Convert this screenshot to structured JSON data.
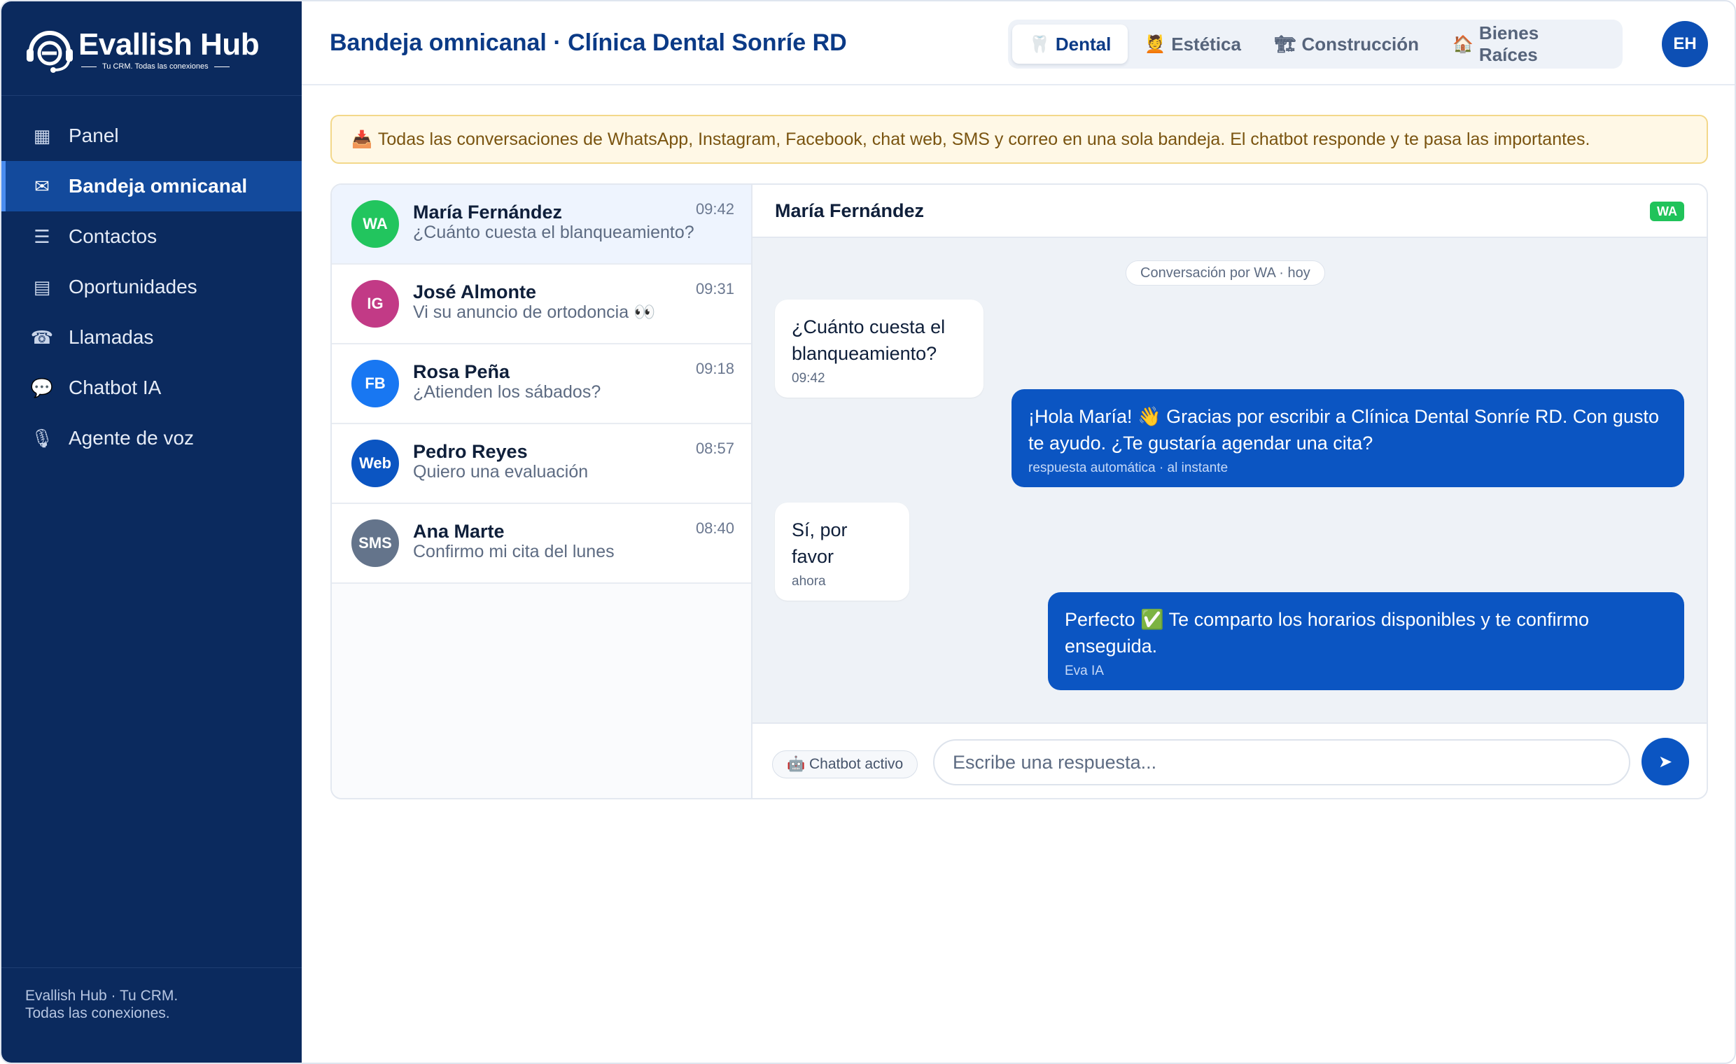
{
  "brand": {
    "name": "Evallish Hub",
    "tagline": "Tu CRM. Todas las conexiones",
    "footer_line1": "Evallish Hub · Tu CRM.",
    "footer_line2": "Todas las conexiones."
  },
  "sidebar": {
    "items": [
      {
        "label": "Panel",
        "icon": "grid-icon",
        "glyph": "▦",
        "active": false
      },
      {
        "label": "Bandeja omnicanal",
        "icon": "envelope-icon",
        "glyph": "✉",
        "active": true
      },
      {
        "label": "Contactos",
        "icon": "list-icon",
        "glyph": "☰",
        "active": false
      },
      {
        "label": "Oportunidades",
        "icon": "board-icon",
        "glyph": "▤",
        "active": false
      },
      {
        "label": "Llamadas",
        "icon": "phone-icon",
        "glyph": "☎",
        "active": false
      },
      {
        "label": "Chatbot IA",
        "icon": "chat-bubble-icon",
        "glyph": "💬",
        "active": false
      },
      {
        "label": "Agente de voz",
        "icon": "microphone-icon",
        "glyph": "🎙",
        "active": false
      }
    ]
  },
  "header": {
    "title": "Bandeja omnicanal · Clínica Dental Sonríe RD",
    "tabs": [
      {
        "label": "Dental",
        "icon": "tooth-icon",
        "glyph": "🦷",
        "active": true
      },
      {
        "label": "Estética",
        "icon": "salon-icon",
        "glyph": "💆",
        "active": false
      },
      {
        "label": "Construcción",
        "icon": "crane-icon",
        "glyph": "🏗",
        "active": false
      },
      {
        "label": "Bienes Raíces",
        "icon": "house-icon",
        "glyph": "🏠",
        "active": false
      }
    ],
    "avatar": "EH"
  },
  "banner": {
    "icon": "📥",
    "text": "Todas las conversaciones de WhatsApp, Instagram, Facebook, chat web, SMS y correo en una sola bandeja. El chatbot responde y te pasa las importantes."
  },
  "conversations": [
    {
      "channel": "WA",
      "color": "#22c55e",
      "name": "María Fernández",
      "preview": "¿Cuánto cuesta el blanqueamiento?",
      "time": "09:42",
      "selected": true
    },
    {
      "channel": "IG",
      "color": "#c23a86",
      "name": "José Almonte",
      "preview": "Vi su anuncio de ortodoncia 👀",
      "time": "09:31",
      "selected": false
    },
    {
      "channel": "FB",
      "color": "#1877f2",
      "name": "Rosa Peña",
      "preview": "¿Atienden los sábados?",
      "time": "09:18",
      "selected": false
    },
    {
      "channel": "Web",
      "color": "#0b55c2",
      "name": "Pedro Reyes",
      "preview": "Quiero una evaluación",
      "time": "08:57",
      "selected": false
    },
    {
      "channel": "SMS",
      "color": "#64748b",
      "name": "Ana Marte",
      "preview": "Confirmo mi cita del lunes",
      "time": "08:40",
      "selected": false
    }
  ],
  "chat": {
    "contact_name": "María Fernández",
    "channel_badge": "WA",
    "channel_color": "#22c55e",
    "day_label": "Conversación por WA · hoy",
    "messages": [
      {
        "dir": "in",
        "text": "¿Cuánto cuesta el blanqueamiento?",
        "meta": "09:42"
      },
      {
        "dir": "out",
        "text": "¡Hola María! 👋 Gracias por escribir a Clínica Dental Sonríe RD. Con gusto te ayudo. ¿Te gustaría agendar una cita?",
        "meta": "respuesta automática · al instante"
      },
      {
        "dir": "in",
        "text": "Sí, por favor",
        "meta": "ahora"
      },
      {
        "dir": "out",
        "text": "Perfecto ✅ Te comparto los horarios disponibles y te confirmo enseguida.",
        "meta": "Eva IA"
      }
    ],
    "chatbot_status": "🤖 Chatbot activo",
    "reply_placeholder": "Escribe una respuesta...",
    "reply_value": "",
    "send_icon": "➤"
  }
}
